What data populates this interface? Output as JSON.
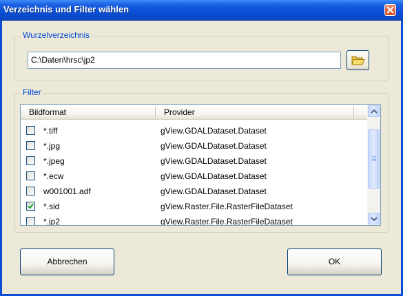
{
  "window": {
    "title": "Verzeichnis und Filter wählen"
  },
  "root_group": {
    "legend": "Wurzelverzeichnis",
    "path_value": "C:\\Daten\\hrsc\\jp2"
  },
  "filter_group": {
    "legend": "Filter",
    "columns": [
      "Bildformat",
      "Provider"
    ],
    "rows": [
      {
        "format": "*.tiff",
        "provider": "gView.GDALDataset.Dataset",
        "checked": false
      },
      {
        "format": "*.jpg",
        "provider": "gView.GDALDataset.Dataset",
        "checked": false
      },
      {
        "format": "*.jpeg",
        "provider": "gView.GDALDataset.Dataset",
        "checked": false
      },
      {
        "format": "*.ecw",
        "provider": "gView.GDALDataset.Dataset",
        "checked": false
      },
      {
        "format": "w001001.adf",
        "provider": "gView.GDALDataset.Dataset",
        "checked": false
      },
      {
        "format": "*.sid",
        "provider": "gView.Raster.File.RasterFileDataset",
        "checked": true
      },
      {
        "format": "*.jp2",
        "provider": "gView.Raster.File.RasterFileDataset",
        "checked": false
      }
    ]
  },
  "buttons": {
    "cancel_label": "Abbrechen",
    "ok_label": "OK"
  },
  "colors": {
    "titlebar": "#0a4fd6",
    "legend_text": "#0046d5",
    "check_mark": "#21a121"
  },
  "icons": {
    "browse": "folder-icon",
    "close": "close-icon"
  }
}
